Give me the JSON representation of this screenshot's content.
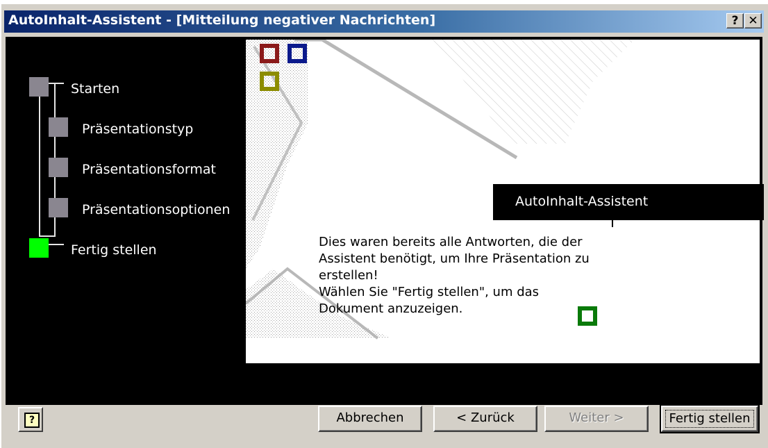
{
  "window": {
    "title": "AutoInhalt-Assistent - [Mitteilung negativer Nachrichten]",
    "help_glyph": "?",
    "close_glyph": "✕"
  },
  "steps": [
    {
      "label": "Starten",
      "state": "done"
    },
    {
      "label": "Präsentationstyp",
      "state": "done"
    },
    {
      "label": "Präsentationsformat",
      "state": "done"
    },
    {
      "label": "Präsentationsoptionen",
      "state": "done"
    },
    {
      "label": "Fertig stellen",
      "state": "active"
    }
  ],
  "panel": {
    "header": "AutoInhalt-Assistent",
    "message_lines": [
      "Dies waren bereits alle Antworten, die der",
      "Assistent benötigt, um Ihre Präsentation zu",
      "erstellen!",
      "Wählen Sie \"Fertig stellen\", um das",
      "Dokument anzuzeigen."
    ]
  },
  "decor_colors": {
    "red": "#8b1a1a",
    "blue": "#0b1a8c",
    "olive": "#8c8c00",
    "green": "#0a7a0a",
    "step_done": "#8a8690",
    "step_active": "#00ff00"
  },
  "buttons": {
    "help_icon": "?",
    "cancel": "Abbrechen",
    "back": "< Zurück",
    "next": "Weiter >",
    "finish": "Fertig stellen"
  }
}
